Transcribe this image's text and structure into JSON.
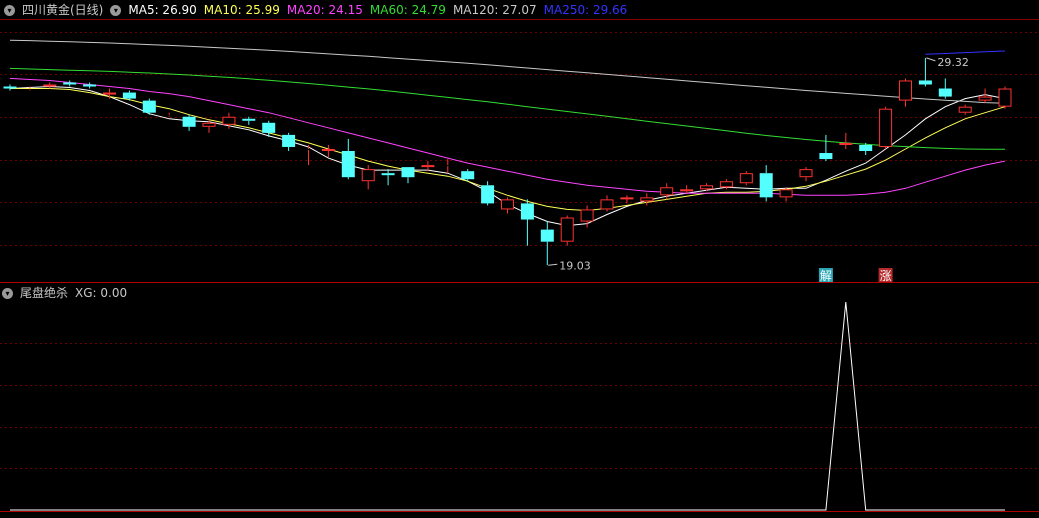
{
  "main": {
    "title": "四川黄金(日线)",
    "indicators": [
      {
        "label": "MA5: 26.90",
        "color": "#ffffff"
      },
      {
        "label": "MA10: 25.99",
        "color": "#ffff55"
      },
      {
        "label": "MA20: 24.15",
        "color": "#ff44ff"
      },
      {
        "label": "MA60: 24.79",
        "color": "#33dd33"
      },
      {
        "label": "MA120: 27.07",
        "color": "#c8c8c8"
      },
      {
        "label": "MA250: 29.66",
        "color": "#3333ff"
      }
    ]
  },
  "sub": {
    "title": "尾盘绝杀",
    "indicator": {
      "label": "XG: 0.00",
      "color": "#c8c8c8"
    }
  },
  "chart_data": [
    {
      "type": "candlestick",
      "title": "四川黄金(日线)",
      "ylim": [
        18.2,
        31.2
      ],
      "colors": {
        "up": "#ff3232",
        "down": "#54ffff",
        "ma5": "#ffffff",
        "ma10": "#ffff55",
        "ma20": "#ff44ff",
        "ma60": "#33dd33",
        "ma120": "#c8c8c8",
        "ma250": "#3333ff"
      },
      "candles": [
        [
          27.9,
          27.8,
          28.0,
          27.7
        ],
        [
          27.8,
          27.8,
          27.9,
          27.7
        ],
        [
          27.9,
          28.0,
          28.1,
          27.8
        ],
        [
          28.1,
          28.0,
          28.2,
          27.9
        ],
        [
          28.0,
          27.9,
          28.1,
          27.8
        ],
        [
          27.5,
          27.6,
          27.8,
          27.3
        ],
        [
          27.6,
          27.3,
          27.7,
          27.2
        ],
        [
          27.2,
          26.6,
          27.3,
          26.5
        ],
        [
          26.5,
          26.5,
          26.6,
          26.4
        ],
        [
          26.4,
          25.9,
          26.5,
          25.7
        ],
        [
          25.9,
          26.1,
          26.2,
          25.6
        ],
        [
          26.0,
          26.4,
          26.6,
          25.8
        ],
        [
          26.3,
          26.2,
          26.4,
          26.0
        ],
        [
          26.1,
          25.6,
          26.2,
          25.4
        ],
        [
          25.5,
          24.9,
          25.6,
          24.7
        ],
        [
          24.8,
          24.8,
          25.0,
          24.0
        ],
        [
          24.7,
          24.8,
          25.0,
          24.4
        ],
        [
          24.7,
          23.4,
          25.3,
          23.3
        ],
        [
          23.2,
          23.8,
          24.0,
          22.8
        ],
        [
          23.6,
          23.5,
          23.8,
          23.0
        ],
        [
          23.9,
          23.4,
          23.9,
          23.1
        ],
        [
          23.9,
          24.0,
          24.2,
          23.7
        ],
        [
          24.0,
          24.0,
          24.3,
          23.6
        ],
        [
          23.7,
          23.3,
          23.8,
          23.2
        ],
        [
          23.0,
          22.1,
          23.2,
          22.0
        ],
        [
          21.8,
          22.3,
          22.4,
          21.6
        ],
        [
          22.1,
          21.3,
          22.3,
          20.0
        ],
        [
          20.8,
          20.2,
          21.2,
          19.03
        ],
        [
          20.2,
          21.4,
          21.5,
          20.0
        ],
        [
          21.2,
          21.8,
          22.0,
          20.9
        ],
        [
          21.8,
          22.3,
          22.5,
          21.7
        ],
        [
          22.3,
          22.4,
          22.5,
          22.1
        ],
        [
          22.2,
          22.4,
          22.6,
          22.0
        ],
        [
          22.5,
          22.9,
          23.1,
          22.3
        ],
        [
          22.7,
          22.8,
          23.0,
          22.6
        ],
        [
          22.8,
          23.0,
          23.1,
          22.7
        ],
        [
          22.9,
          23.2,
          23.3,
          22.8
        ],
        [
          23.1,
          23.6,
          23.7,
          23.0
        ],
        [
          23.6,
          22.4,
          24.0,
          22.2
        ],
        [
          22.4,
          22.8,
          22.9,
          22.2
        ],
        [
          23.4,
          23.8,
          23.9,
          23.2
        ],
        [
          24.6,
          24.3,
          25.5,
          24.2
        ],
        [
          25.0,
          25.1,
          25.6,
          24.8
        ],
        [
          25.0,
          24.7,
          25.1,
          24.5
        ],
        [
          24.9,
          26.8,
          26.9,
          24.8
        ],
        [
          27.2,
          28.2,
          28.3,
          26.9
        ],
        [
          28.2,
          28.0,
          29.32,
          27.9
        ],
        [
          27.8,
          27.4,
          28.3,
          27.3
        ],
        [
          26.6,
          26.9,
          27.0,
          26.5
        ],
        [
          27.2,
          27.4,
          27.8,
          27.1
        ],
        [
          26.9,
          27.8,
          27.9,
          26.8
        ]
      ],
      "ma_series": [
        {
          "key": "ma5",
          "values": [
            27.8,
            27.85,
            27.9,
            27.85,
            27.7,
            27.4,
            27.0,
            26.55,
            26.3,
            26.2,
            26.15,
            25.95,
            25.75,
            25.45,
            25.2,
            24.9,
            24.35,
            24.0,
            23.75,
            23.75,
            23.75,
            23.75,
            23.6,
            23.2,
            22.7,
            22.05,
            21.6,
            21.2,
            21.0,
            21.1,
            21.55,
            21.95,
            22.25,
            22.45,
            22.6,
            22.75,
            22.9,
            22.85,
            22.8,
            22.85,
            22.85,
            23.25,
            23.7,
            24.1,
            24.8,
            25.5,
            26.3,
            26.9,
            27.3,
            27.5,
            27.3
          ]
        },
        {
          "key": "ma10",
          "values": [
            27.8,
            27.8,
            27.8,
            27.75,
            27.6,
            27.4,
            27.25,
            27.0,
            26.8,
            26.5,
            26.25,
            26.05,
            25.85,
            25.6,
            25.35,
            25.1,
            24.8,
            24.5,
            24.2,
            23.95,
            23.75,
            23.6,
            23.45,
            23.2,
            22.85,
            22.5,
            22.2,
            21.95,
            21.8,
            21.75,
            21.85,
            22.0,
            22.15,
            22.3,
            22.45,
            22.6,
            22.65,
            22.65,
            22.7,
            22.8,
            22.95,
            23.2,
            23.5,
            23.8,
            24.25,
            24.8,
            25.35,
            25.85,
            26.3,
            26.6,
            26.9
          ]
        },
        {
          "key": "ma20",
          "values": [
            28.3,
            28.25,
            28.2,
            28.1,
            28.0,
            27.9,
            27.8,
            27.65,
            27.55,
            27.4,
            27.2,
            27.0,
            26.8,
            26.6,
            26.35,
            26.1,
            25.85,
            25.6,
            25.35,
            25.1,
            24.85,
            24.6,
            24.35,
            24.1,
            23.9,
            23.7,
            23.5,
            23.3,
            23.15,
            23.0,
            22.9,
            22.8,
            22.7,
            22.65,
            22.6,
            22.6,
            22.6,
            22.6,
            22.6,
            22.55,
            22.5,
            22.5,
            22.5,
            22.55,
            22.65,
            22.85,
            23.15,
            23.45,
            23.75,
            24.0,
            24.2
          ]
        },
        {
          "key": "ma60",
          "values": [
            28.8,
            28.77,
            28.74,
            28.71,
            28.68,
            28.65,
            28.61,
            28.57,
            28.52,
            28.47,
            28.41,
            28.35,
            28.28,
            28.21,
            28.13,
            28.05,
            27.96,
            27.87,
            27.78,
            27.68,
            27.58,
            27.47,
            27.36,
            27.25,
            27.14,
            27.02,
            26.9,
            26.78,
            26.66,
            26.54,
            26.42,
            26.3,
            26.18,
            26.06,
            25.94,
            25.82,
            25.7,
            25.58,
            25.47,
            25.37,
            25.27,
            25.18,
            25.1,
            25.03,
            24.97,
            24.92,
            24.87,
            24.83,
            24.8,
            24.79,
            24.79
          ]
        },
        {
          "key": "ma120",
          "values": [
            30.2,
            30.18,
            30.15,
            30.12,
            30.09,
            30.06,
            30.02,
            29.98,
            29.94,
            29.9,
            29.85,
            29.8,
            29.75,
            29.7,
            29.64,
            29.58,
            29.52,
            29.46,
            29.4,
            29.33,
            29.26,
            29.19,
            29.12,
            29.05,
            28.98,
            28.9,
            28.82,
            28.74,
            28.66,
            28.58,
            28.5,
            28.42,
            28.34,
            28.26,
            28.18,
            28.1,
            28.02,
            27.94,
            27.86,
            27.78,
            27.7,
            27.63,
            27.56,
            27.49,
            27.42,
            27.35,
            27.28,
            27.22,
            27.16,
            27.1,
            27.07
          ]
        },
        {
          "key": "ma250",
          "values": [
            null,
            null,
            null,
            null,
            null,
            null,
            null,
            null,
            null,
            null,
            null,
            null,
            null,
            null,
            null,
            null,
            null,
            null,
            null,
            null,
            null,
            null,
            null,
            null,
            null,
            null,
            null,
            null,
            null,
            null,
            null,
            null,
            null,
            null,
            null,
            null,
            null,
            null,
            null,
            null,
            null,
            null,
            null,
            null,
            null,
            null,
            29.5,
            29.54,
            29.58,
            29.62,
            29.66
          ]
        }
      ],
      "annotations": [
        {
          "label": "29.32",
          "candle": 46,
          "price": 29.32,
          "kind": "high"
        },
        {
          "label": "19.03",
          "candle": 27,
          "price": 19.03,
          "kind": "low"
        }
      ],
      "markers": [
        {
          "label": "解",
          "candle": 41,
          "bg": "#2aa6b5",
          "color": "#ffffff"
        },
        {
          "label": "涨",
          "candle": 44,
          "bg": "#b52a2a",
          "color": "#ffffff"
        }
      ]
    },
    {
      "type": "line",
      "title": "尾盘绝杀",
      "series": [
        {
          "name": "XG",
          "color": "#ffffff",
          "values": [
            0,
            0,
            0,
            0,
            0,
            0,
            0,
            0,
            0,
            0,
            0,
            0,
            0,
            0,
            0,
            0,
            0,
            0,
            0,
            0,
            0,
            0,
            0,
            0,
            0,
            0,
            0,
            0,
            0,
            0,
            0,
            0,
            0,
            0,
            0,
            0,
            0,
            0,
            0,
            0,
            0,
            0,
            1,
            0,
            0,
            0,
            0,
            0,
            0,
            0,
            0
          ]
        }
      ],
      "ylim": [
        0,
        1
      ]
    }
  ]
}
